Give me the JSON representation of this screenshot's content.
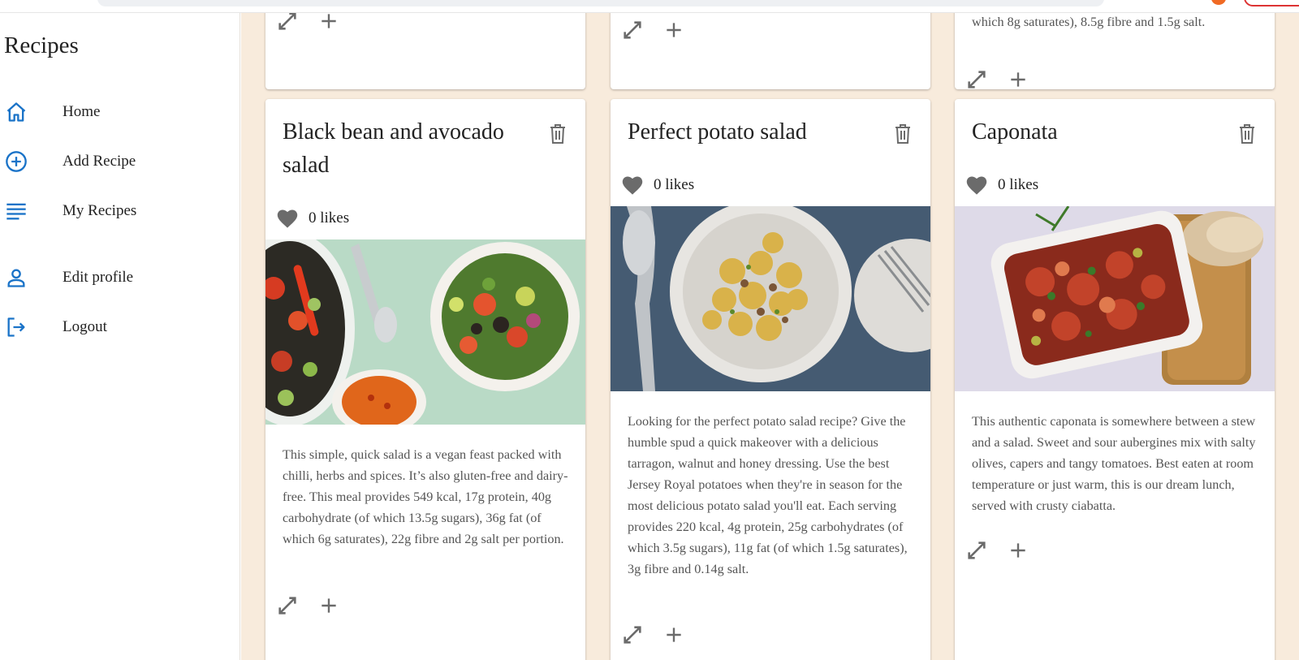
{
  "sidebar": {
    "title": "Recipes",
    "items": [
      {
        "label": "Home",
        "icon": "home-icon"
      },
      {
        "label": "Add Recipe",
        "icon": "add-circle-icon"
      },
      {
        "label": "My Recipes",
        "icon": "list-icon"
      },
      {
        "label": "Edit profile",
        "icon": "person-icon"
      },
      {
        "label": "Logout",
        "icon": "logout-icon"
      }
    ],
    "accent_color": "#1a73c8"
  },
  "top_cards": [
    {
      "text": ""
    },
    {
      "text": ""
    },
    {
      "text": "which 8g saturates), 8.5g fibre and 1.5g salt."
    }
  ],
  "cards": [
    {
      "title": "Black bean and avocado salad",
      "likes": "0 likes",
      "description": "This simple, quick salad is a vegan feast packed with chilli, herbs and spices. It’s also gluten-free and dairy-free. This meal provides 549 kcal, 17g protein, 40g carbohydrate (of which 13.5g sugars), 36g fat (of which 6g saturates), 22g fibre and 2g salt per portion."
    },
    {
      "title": "Perfect potato salad",
      "likes": "0 likes",
      "description": "Looking for the perfect potato salad recipe? Give the humble spud a quick makeover with a delicious tarragon, walnut and honey dressing. Use the best Jersey Royal potatoes when they're in season for the most delicious potato salad you'll eat. Each serving provides 220 kcal, 4g protein, 25g carbohydrates (of which 3.5g sugars), 11g fat (of which 1.5g saturates), 3g fibre and 0.14g salt."
    },
    {
      "title": "Caponata",
      "likes": "0 likes",
      "description": "This authentic caponata is somewhere between a stew and a salad. Sweet and sour aubergines mix with salty olives, capers and tangy tomatoes. Best eaten at room temperature or just warm, this is our dream lunch, served with crusty ciabatta."
    }
  ],
  "colors": {
    "background": "#f8ebdc",
    "card": "#ffffff",
    "icon_gray": "#6b6b6b",
    "text": "#222222",
    "description": "#555555"
  }
}
